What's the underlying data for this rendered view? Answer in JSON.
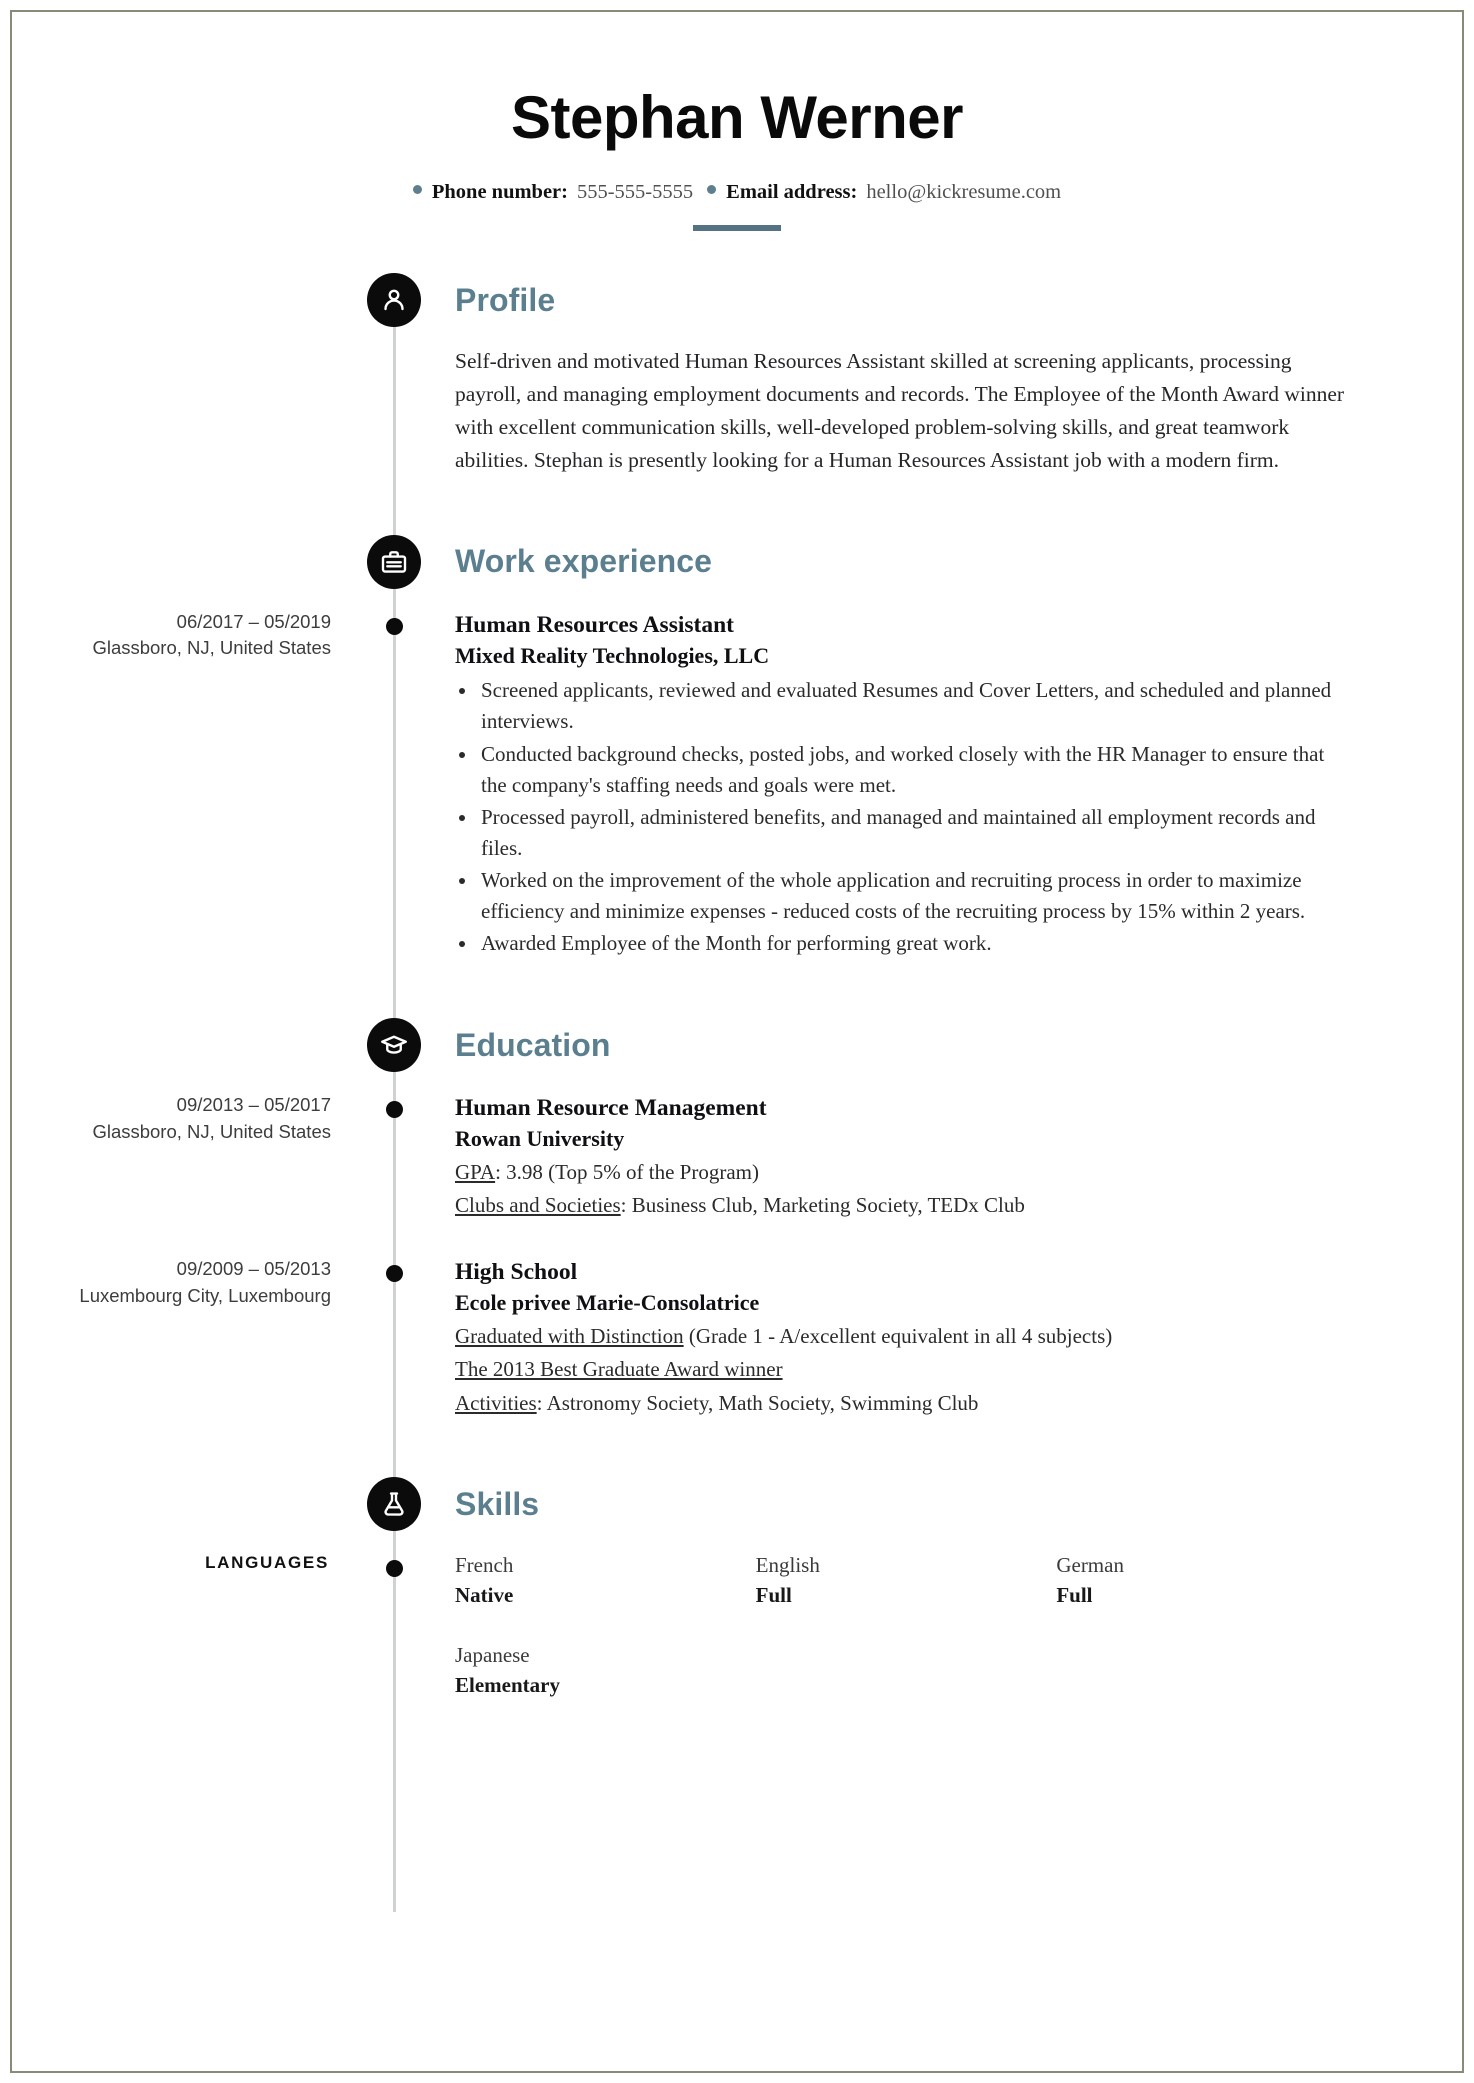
{
  "header": {
    "full_name": "Stephan Werner",
    "contacts": [
      {
        "label": "Phone number:",
        "value": "555-555-5555"
      },
      {
        "label": "Email address:",
        "value": "hello@kickresume.com"
      }
    ]
  },
  "colors": {
    "accent": "#5c7f90",
    "rule": "#547282",
    "icon_bg": "#0b0b0b",
    "timeline": "#cfd2d4",
    "page_border": "#8a8a78"
  },
  "sections": {
    "profile": {
      "title": "Profile",
      "icon": "person-icon",
      "text": "Self-driven and motivated Human Resources Assistant skilled at screening applicants, processing payroll, and managing employment documents and records. The Employee of the Month Award winner with excellent communication skills, well-developed problem-solving skills, and great teamwork abilities. Stephan is presently looking for a Human Resources Assistant job with a modern firm."
    },
    "work": {
      "title": "Work experience",
      "icon": "briefcase-icon",
      "entries": [
        {
          "dates": "06/2017 – 05/2019",
          "location": "Glassboro, NJ, United States",
          "title": "Human Resources Assistant",
          "org": "Mixed Reality Technologies, LLC",
          "bullets": [
            "Screened applicants, reviewed and evaluated Resumes and Cover Letters, and scheduled and planned interviews.",
            "Conducted background checks, posted jobs, and worked closely with the HR Manager to ensure that the company's staffing needs and goals were met.",
            "Processed payroll, administered benefits, and managed and maintained all employment records and files.",
            "Worked on the improvement of the whole application and recruiting process in order to maximize efficiency and minimize expenses - reduced costs of the recruiting process by 15% within 2 years.",
            "Awarded Employee of the Month for performing great work."
          ]
        }
      ]
    },
    "education": {
      "title": "Education",
      "icon": "graduation-cap-icon",
      "entries": [
        {
          "dates": "09/2013 – 05/2017",
          "location": "Glassboro, NJ, United States",
          "title": "Human Resource Management",
          "org": "Rowan University",
          "details": [
            {
              "label": "GPA",
              "rest": ": 3.98 (Top 5% of the Program)"
            },
            {
              "label": "Clubs and Societies",
              "rest": ": Business Club, Marketing Society, TEDx Club"
            }
          ]
        },
        {
          "dates": "09/2009 – 05/2013",
          "location": "Luxembourg City, Luxembourg",
          "title": "High School",
          "org": "Ecole privee Marie-Consolatrice",
          "details": [
            {
              "label": "Graduated with Distinction",
              "rest": " (Grade 1 - A/excellent equivalent in all 4 subjects)"
            },
            {
              "label": "The 2013 Best Graduate Award winner",
              "rest": ""
            },
            {
              "label": "Activities",
              "rest": ": Astronomy Society, Math Society, Swimming Club"
            }
          ]
        }
      ]
    },
    "skills": {
      "title": "Skills",
      "icon": "flask-icon",
      "group_label": "LANGUAGES",
      "languages": [
        {
          "name": "French",
          "level": "Native"
        },
        {
          "name": "English",
          "level": "Full"
        },
        {
          "name": "German",
          "level": "Full"
        },
        {
          "name": "Japanese",
          "level": "Elementary"
        }
      ]
    }
  }
}
